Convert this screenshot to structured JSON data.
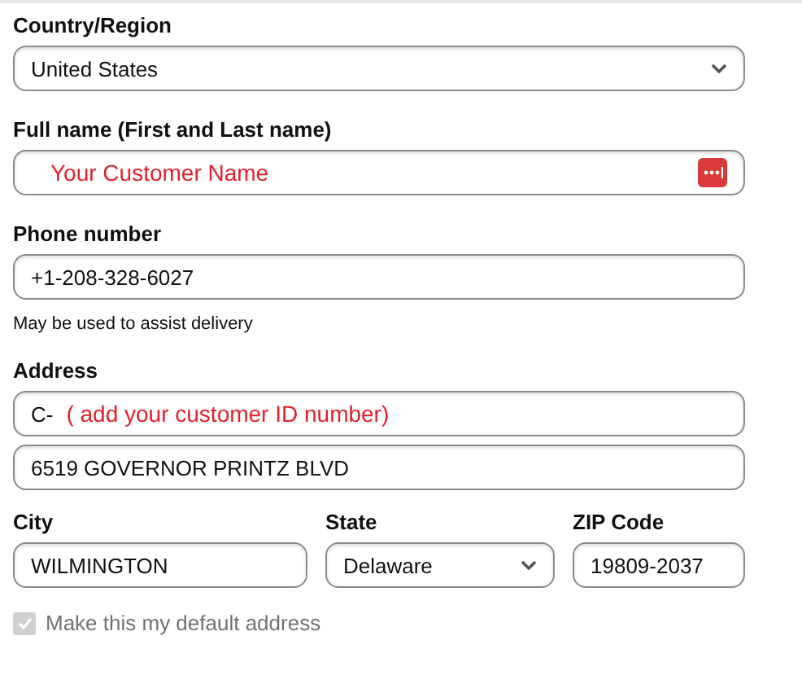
{
  "country": {
    "label": "Country/Region",
    "value": "United States"
  },
  "full_name": {
    "label": "Full name (First and Last name)",
    "note": "Your Customer Name"
  },
  "phone": {
    "label": "Phone number",
    "value": "+1-208-328-6027",
    "hint": "May be used to assist delivery"
  },
  "address": {
    "label": "Address",
    "line1": "C-",
    "line1_note": "( add your customer ID number)",
    "line2": "6519 GOVERNOR PRINTZ BLVD"
  },
  "city": {
    "label": "City",
    "value": "WILMINGTON"
  },
  "state": {
    "label": "State",
    "value": "Delaware"
  },
  "zip": {
    "label": "ZIP Code",
    "value": "19809-2037"
  },
  "default_address": {
    "label": "Make this my default address",
    "checked": true,
    "disabled": true
  }
}
